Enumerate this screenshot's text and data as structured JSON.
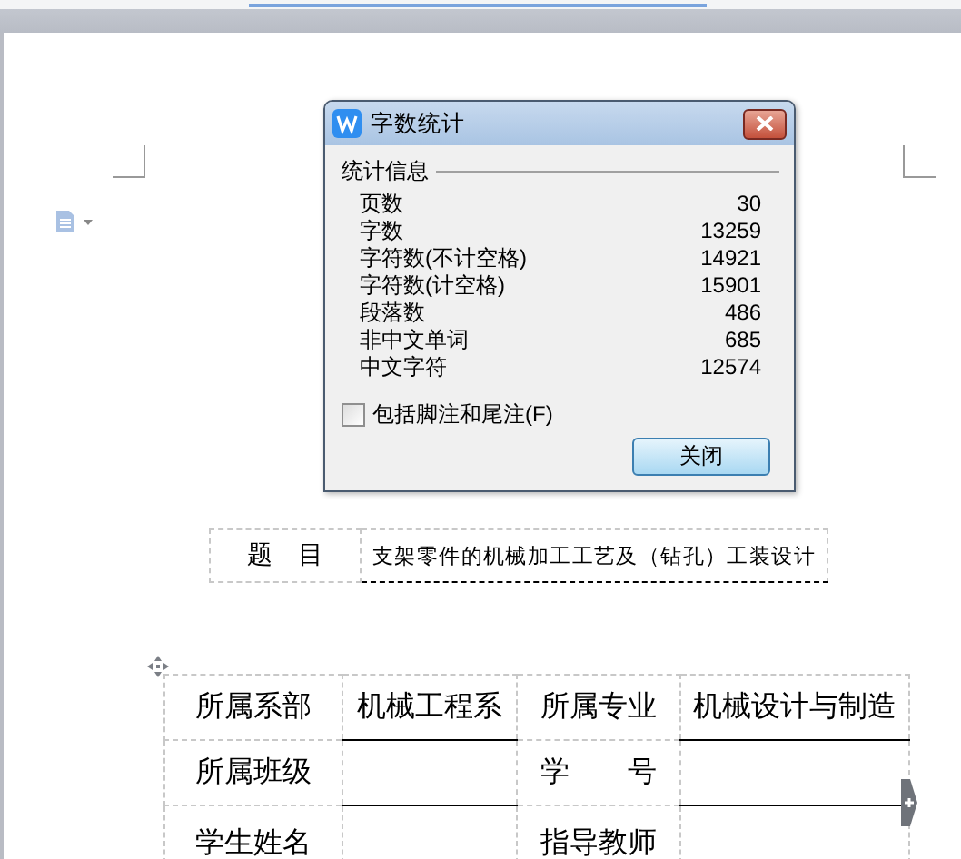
{
  "document": {
    "title_table": {
      "label": "题　目",
      "value": "支架零件的机械加工工艺及（钻孔）工装设计"
    },
    "info_table": {
      "rows": [
        {
          "cells": [
            "所属系部",
            "机械工程系",
            "所属专业",
            "机械设计与制造"
          ]
        },
        {
          "cells": [
            "所属班级",
            null,
            "学　　号",
            null
          ]
        },
        {
          "cells": [
            "学生姓名",
            null,
            "指导教师",
            null
          ]
        }
      ]
    }
  },
  "dialog": {
    "title": "字数统计",
    "group": "统计信息",
    "stats": [
      {
        "label": "页数",
        "value": "30"
      },
      {
        "label": "字数",
        "value": "13259"
      },
      {
        "label": "字符数(不计空格)",
        "value": "14921"
      },
      {
        "label": "字符数(计空格)",
        "value": "15901"
      },
      {
        "label": "段落数",
        "value": "486"
      },
      {
        "label": "非中文单词",
        "value": "685"
      },
      {
        "label": "中文字符",
        "value": "12574"
      }
    ],
    "checkbox": {
      "label": "包括脚注和尾注(F)",
      "checked": false
    },
    "button": "关闭"
  }
}
